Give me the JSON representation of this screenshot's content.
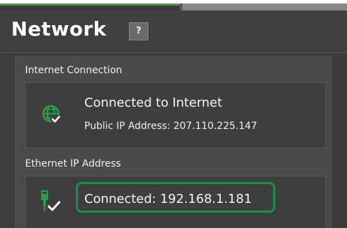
{
  "header": {
    "title": "Network",
    "help_label": "?"
  },
  "internet_connection": {
    "section_label": "Internet Connection",
    "status": "Connected to Internet",
    "public_ip": "Public IP Address: 207.110.225.147",
    "icon": "globe-check-icon"
  },
  "ethernet": {
    "section_label": "Ethernet IP Address",
    "status": "Connected: 192.168.1.181",
    "icon": "ethernet-plug-check-icon"
  },
  "colors": {
    "icon_green": "#2a9d4a",
    "highlight_green": "#16934a"
  }
}
